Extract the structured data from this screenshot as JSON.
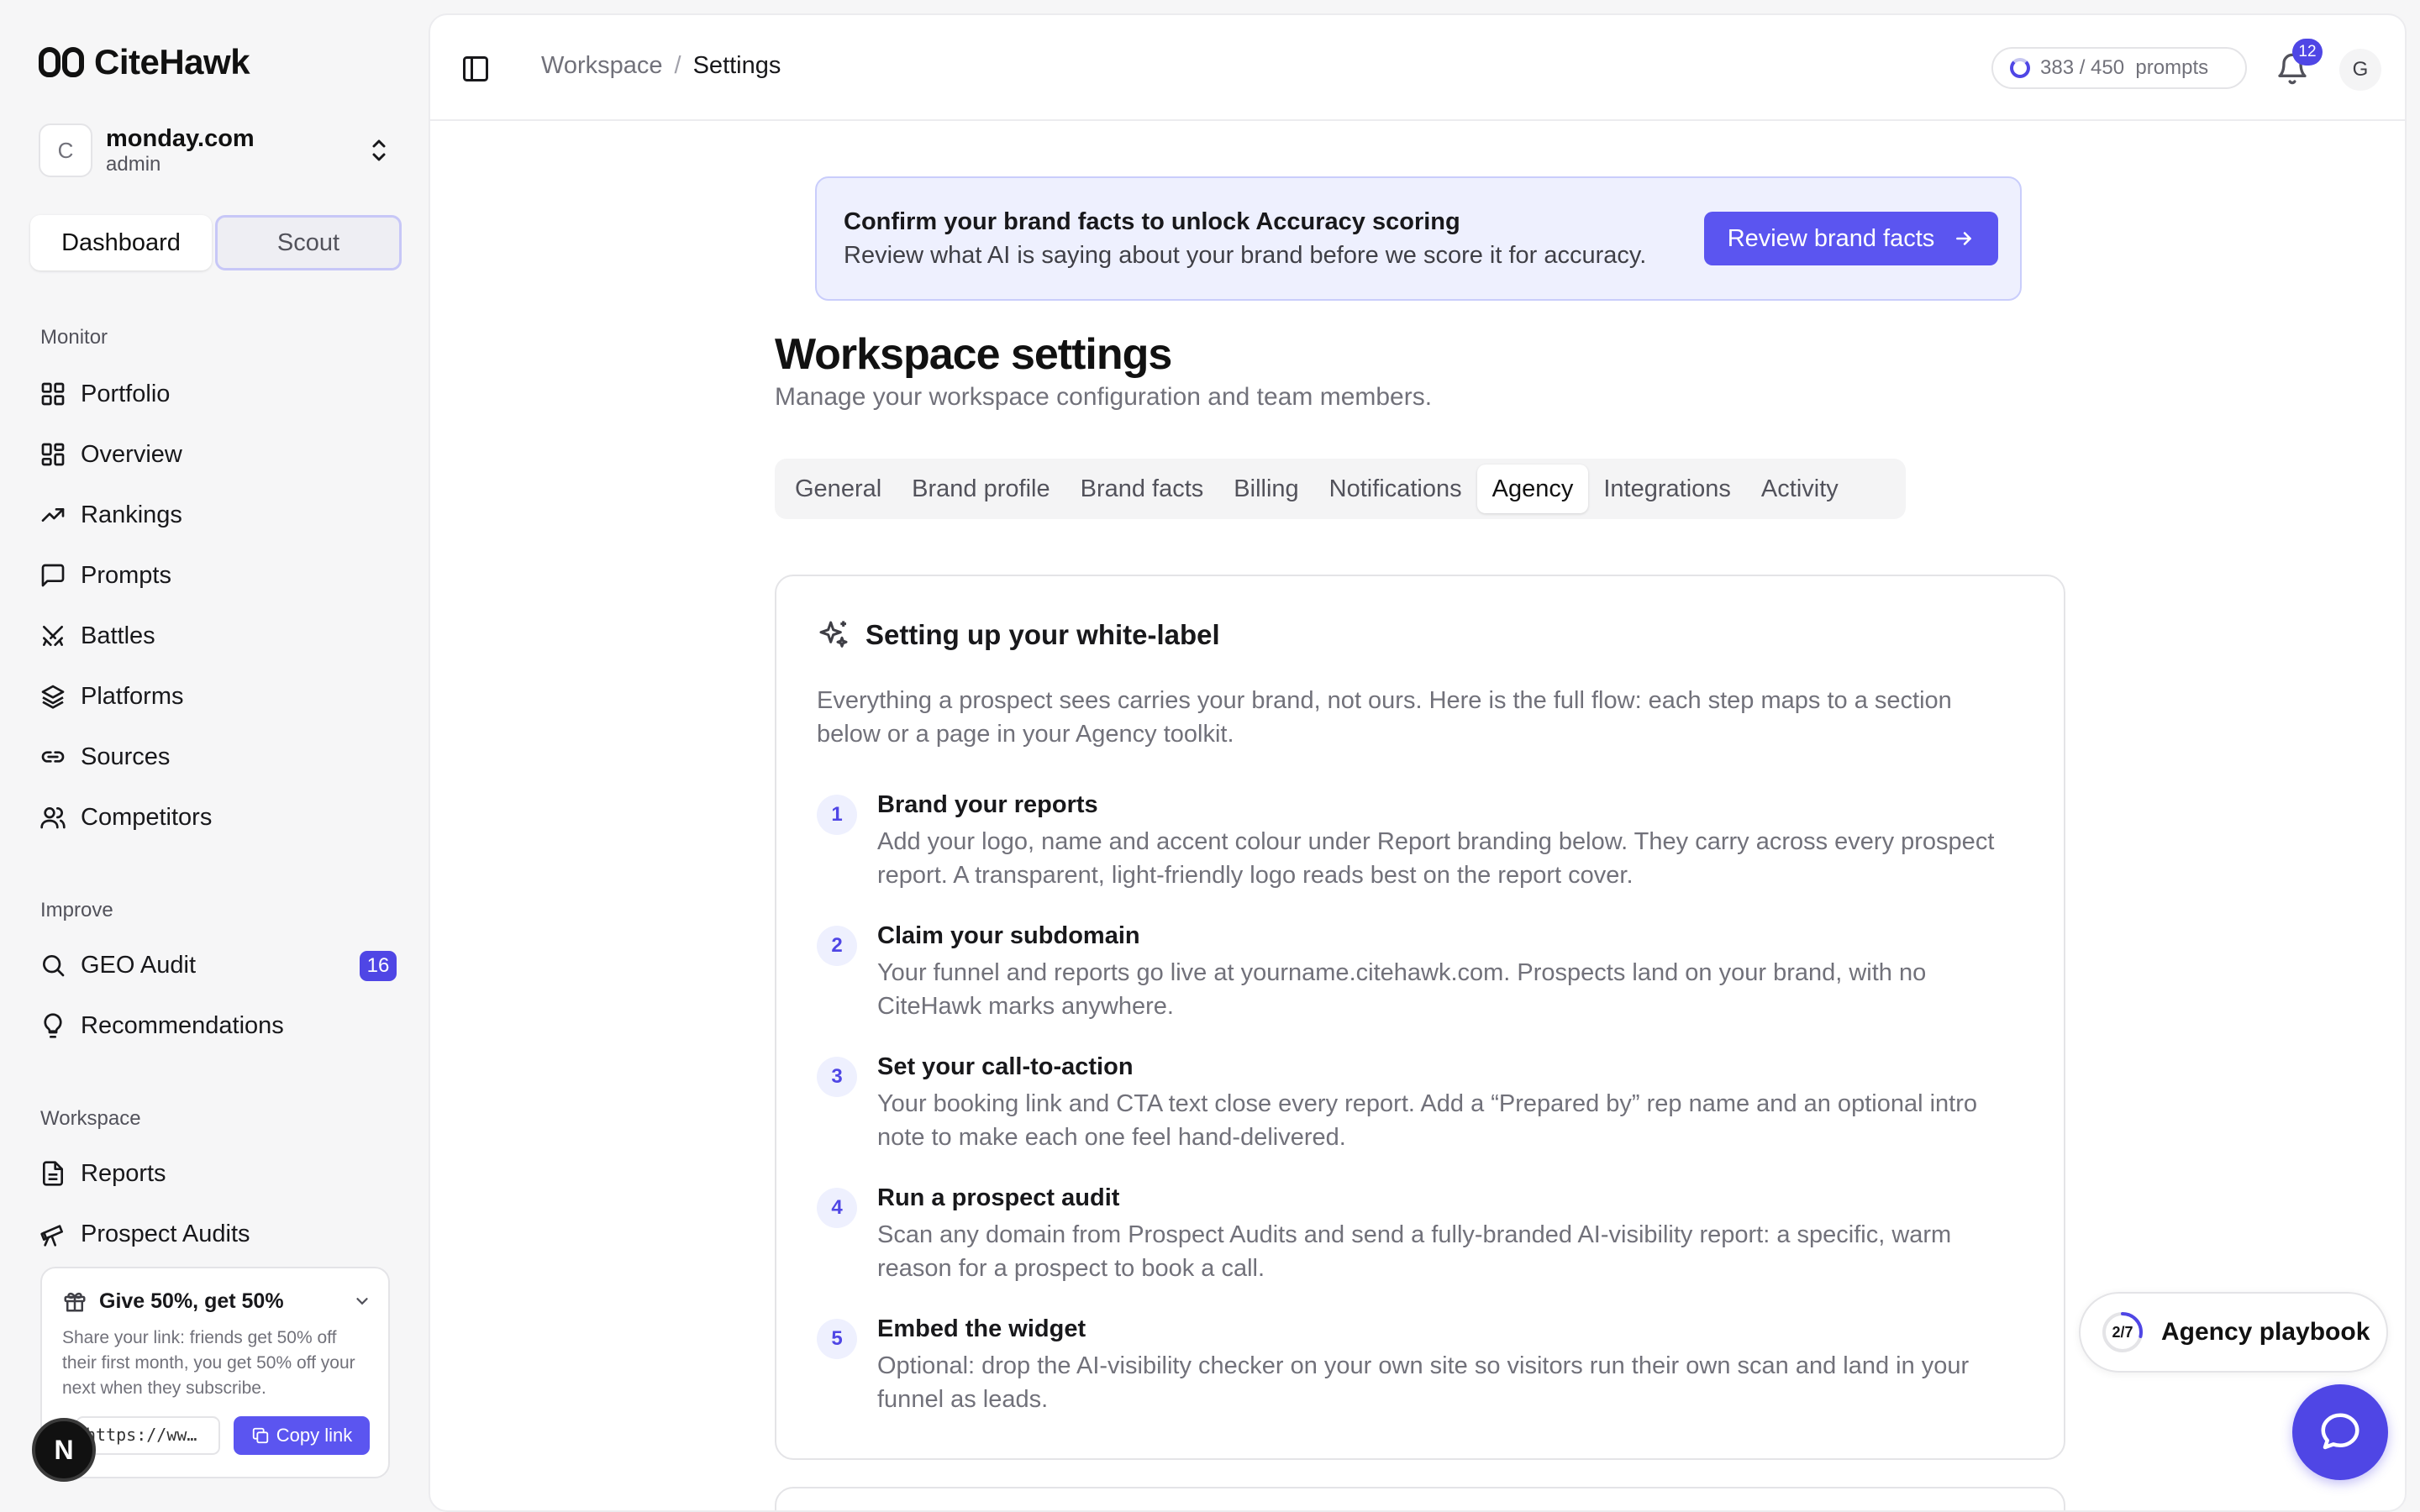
{
  "brand": {
    "name": "CiteHawk",
    "accent": "#4f46e5"
  },
  "org": {
    "initial": "C",
    "name": "monday.com",
    "role": "admin"
  },
  "mode": {
    "dashboard": "Dashboard",
    "scout": "Scout"
  },
  "sidebar": {
    "monitor_label": "Monitor",
    "monitor": [
      {
        "label": "Portfolio",
        "icon": "grid-icon"
      },
      {
        "label": "Overview",
        "icon": "grid-icon"
      },
      {
        "label": "Rankings",
        "icon": "trending-up-icon"
      },
      {
        "label": "Prompts",
        "icon": "message-square-icon"
      },
      {
        "label": "Battles",
        "icon": "swords-icon"
      },
      {
        "label": "Platforms",
        "icon": "layers-icon"
      },
      {
        "label": "Sources",
        "icon": "link-icon"
      },
      {
        "label": "Competitors",
        "icon": "users-icon"
      }
    ],
    "improve_label": "Improve",
    "improve": [
      {
        "label": "GEO Audit",
        "icon": "search-icon",
        "badge": "16"
      },
      {
        "label": "Recommendations",
        "icon": "lightbulb-icon"
      }
    ],
    "workspace_label": "Workspace",
    "workspace": [
      {
        "label": "Reports",
        "icon": "file-text-icon"
      },
      {
        "label": "Prospect Audits",
        "icon": "telescope-icon"
      }
    ]
  },
  "referral": {
    "title": "Give 50%, get 50%",
    "body": "Share your link: friends get 50% off their first month, you get 50% off your next when they subscribe.",
    "url": "https://ww…",
    "copy_label": "Copy link"
  },
  "next_badge": "N",
  "header": {
    "breadcrumb": [
      "Workspace",
      "Settings"
    ],
    "separator": "/",
    "usage": "383 / 450  prompts",
    "notifications": "12",
    "user_initial": "G"
  },
  "banner": {
    "title": "Confirm your brand facts to unlock Accuracy scoring",
    "subtitle": "Review what AI is saying about your brand before we score it for accuracy.",
    "button": "Review brand facts"
  },
  "page": {
    "title": "Workspace settings",
    "subtitle": "Manage your workspace configuration and team members."
  },
  "tabs": [
    "General",
    "Brand profile",
    "Brand facts",
    "Billing",
    "Notifications",
    "Agency",
    "Integrations",
    "Activity"
  ],
  "active_tab": "Agency",
  "card": {
    "title": "Setting up your white-label",
    "intro": "Everything a prospect sees carries your brand, not ours. Here is the full flow: each step maps to a section below or a page in your Agency toolkit.",
    "steps": [
      {
        "num": "1",
        "title": "Brand your reports",
        "desc": "Add your logo, name and accent colour under Report branding below. They carry across every prospect report. A transparent, light-friendly logo reads best on the report cover."
      },
      {
        "num": "2",
        "title": "Claim your subdomain",
        "desc": "Your funnel and reports go live at yourname.citehawk.com. Prospects land on your brand, with no CiteHawk marks anywhere."
      },
      {
        "num": "3",
        "title": "Set your call-to-action",
        "desc": "Your booking link and CTA text close every report. Add a “Prepared by” rep name and an optional intro note to make each one feel hand-delivered."
      },
      {
        "num": "4",
        "title": "Run a prospect audit",
        "desc": "Scan any domain from Prospect Audits and send a fully-branded AI-visibility report: a specific, warm reason for a prospect to book a call."
      },
      {
        "num": "5",
        "title": "Embed the widget",
        "desc": "Optional: drop the AI-visibility checker on your own site so visitors run their own scan and land in your funnel as leads."
      }
    ]
  },
  "playbook": {
    "progress": "2/7",
    "progress_fraction": 0.2857,
    "label": "Agency playbook"
  }
}
